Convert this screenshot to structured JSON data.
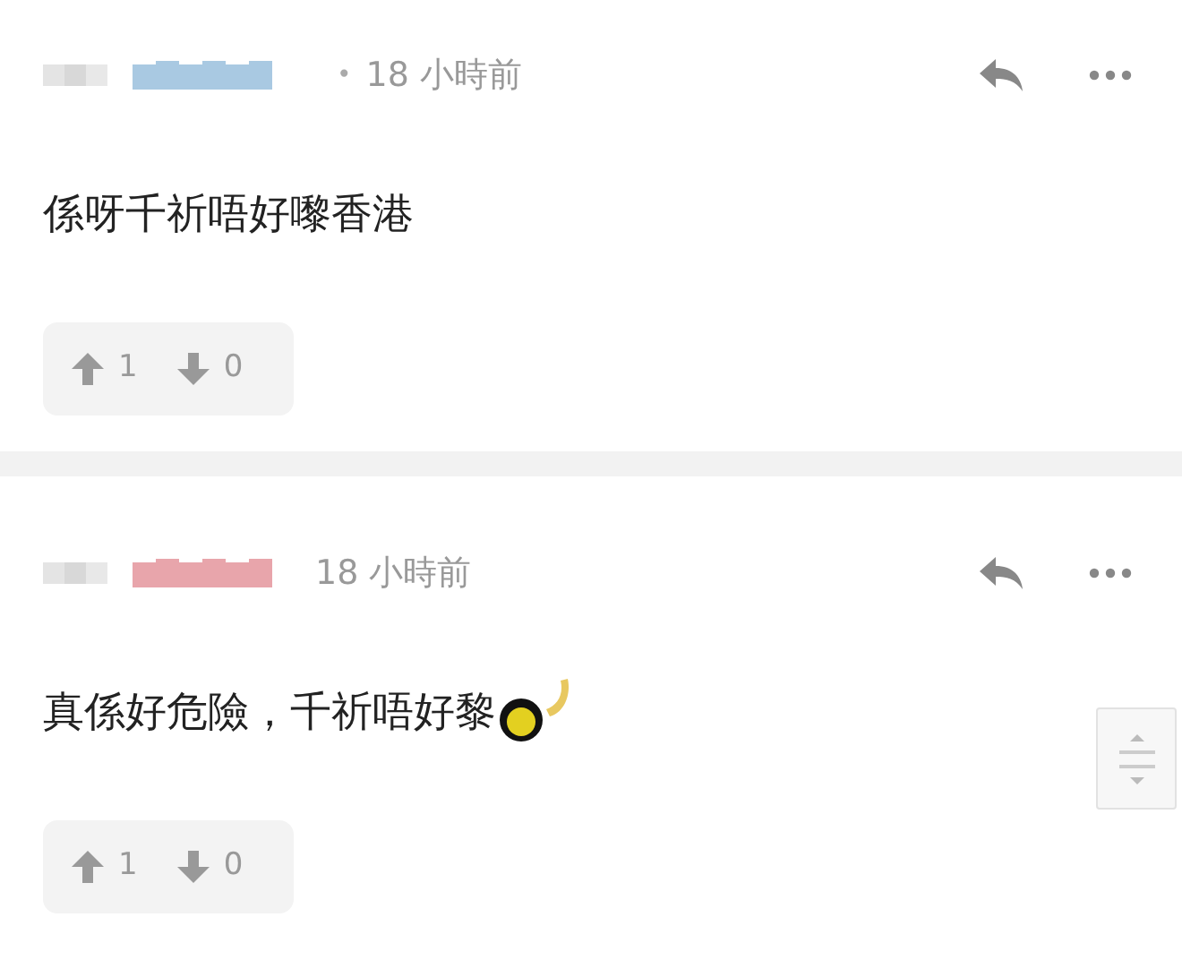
{
  "comments": [
    {
      "color": "#a9c9e2",
      "separator": "•",
      "time": "18 小時前",
      "text": "係呀千祈唔好嚟香港",
      "emoji": false,
      "upvotes": "1",
      "downvotes": "0"
    },
    {
      "color": "#e8a5ab",
      "time": "18 小時前",
      "text": "真係好危險，千祈唔好黎",
      "emoji": true,
      "upvotes": "1",
      "downvotes": "0"
    }
  ]
}
